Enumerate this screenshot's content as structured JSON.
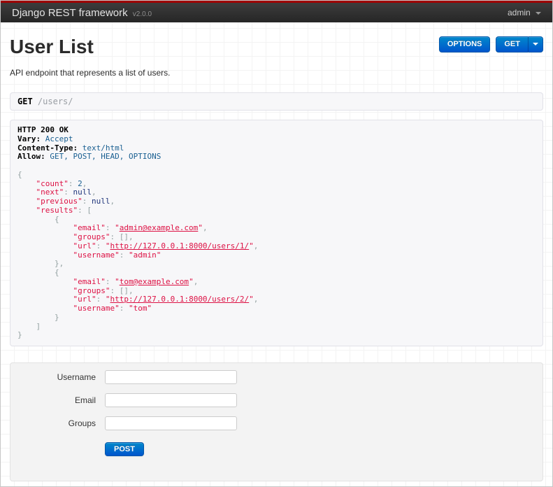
{
  "navbar": {
    "brand": "Django REST framework",
    "version": "v2.0.0",
    "user_menu": "admin"
  },
  "header": {
    "title": "User List",
    "description": "API endpoint that represents a list of users.",
    "options_button": "OPTIONS",
    "get_button": "GET"
  },
  "request_bar": {
    "method": "GET",
    "path": "/users/"
  },
  "response": {
    "status_line": "HTTP 200 OK",
    "headers": [
      {
        "name": "Vary:",
        "value": "Accept"
      },
      {
        "name": "Content-Type:",
        "value": "text/html"
      },
      {
        "name": "Allow:",
        "value": "GET, POST, HEAD, OPTIONS"
      }
    ],
    "body_json": {
      "count": 2,
      "next": null,
      "previous": null,
      "results": [
        {
          "email": "admin@example.com",
          "groups": [],
          "url": "http://127.0.0.1:8000/users/1/",
          "username": "admin"
        },
        {
          "email": "tom@example.com",
          "groups": [],
          "url": "http://127.0.0.1:8000/users/2/",
          "username": "tom"
        }
      ]
    },
    "lines": [
      [
        {
          "t": "b",
          "v": "HTTP 200 OK"
        }
      ],
      [
        {
          "t": "b",
          "v": "Vary:"
        },
        {
          "t": "pln",
          "v": " "
        },
        {
          "t": "lit",
          "v": "Accept"
        }
      ],
      [
        {
          "t": "b",
          "v": "Content-Type:"
        },
        {
          "t": "pln",
          "v": " "
        },
        {
          "t": "lit",
          "v": "text/html"
        }
      ],
      [
        {
          "t": "b",
          "v": "Allow:"
        },
        {
          "t": "pln",
          "v": " "
        },
        {
          "t": "lit",
          "v": "GET, POST, HEAD, OPTIONS"
        }
      ],
      [],
      [
        {
          "t": "pun",
          "v": "{"
        }
      ],
      [
        {
          "t": "pln",
          "v": "    "
        },
        {
          "t": "str",
          "v": "\"count\""
        },
        {
          "t": "pun",
          "v": ": "
        },
        {
          "t": "lit",
          "v": "2"
        },
        {
          "t": "pun",
          "v": ","
        }
      ],
      [
        {
          "t": "pln",
          "v": "    "
        },
        {
          "t": "str",
          "v": "\"next\""
        },
        {
          "t": "pun",
          "v": ": "
        },
        {
          "t": "kwd",
          "v": "null"
        },
        {
          "t": "pun",
          "v": ","
        }
      ],
      [
        {
          "t": "pln",
          "v": "    "
        },
        {
          "t": "str",
          "v": "\"previous\""
        },
        {
          "t": "pun",
          "v": ": "
        },
        {
          "t": "kwd",
          "v": "null"
        },
        {
          "t": "pun",
          "v": ","
        }
      ],
      [
        {
          "t": "pln",
          "v": "    "
        },
        {
          "t": "str",
          "v": "\"results\""
        },
        {
          "t": "pun",
          "v": ": ["
        }
      ],
      [
        {
          "t": "pln",
          "v": "        "
        },
        {
          "t": "pun",
          "v": "{"
        }
      ],
      [
        {
          "t": "pln",
          "v": "            "
        },
        {
          "t": "str",
          "v": "\"email\""
        },
        {
          "t": "pun",
          "v": ": "
        },
        {
          "t": "str",
          "v": "\""
        },
        {
          "t": "link",
          "v": "admin@example.com"
        },
        {
          "t": "str",
          "v": "\""
        },
        {
          "t": "pun",
          "v": ","
        }
      ],
      [
        {
          "t": "pln",
          "v": "            "
        },
        {
          "t": "str",
          "v": "\"groups\""
        },
        {
          "t": "pun",
          "v": ": [],"
        }
      ],
      [
        {
          "t": "pln",
          "v": "            "
        },
        {
          "t": "str",
          "v": "\"url\""
        },
        {
          "t": "pun",
          "v": ": "
        },
        {
          "t": "str",
          "v": "\""
        },
        {
          "t": "link",
          "v": "http://127.0.0.1:8000/users/1/"
        },
        {
          "t": "str",
          "v": "\""
        },
        {
          "t": "pun",
          "v": ","
        }
      ],
      [
        {
          "t": "pln",
          "v": "            "
        },
        {
          "t": "str",
          "v": "\"username\""
        },
        {
          "t": "pun",
          "v": ": "
        },
        {
          "t": "str",
          "v": "\"admin\""
        }
      ],
      [
        {
          "t": "pln",
          "v": "        "
        },
        {
          "t": "pun",
          "v": "},"
        }
      ],
      [
        {
          "t": "pln",
          "v": "        "
        },
        {
          "t": "pun",
          "v": "{"
        }
      ],
      [
        {
          "t": "pln",
          "v": "            "
        },
        {
          "t": "str",
          "v": "\"email\""
        },
        {
          "t": "pun",
          "v": ": "
        },
        {
          "t": "str",
          "v": "\""
        },
        {
          "t": "link",
          "v": "tom@example.com"
        },
        {
          "t": "str",
          "v": "\""
        },
        {
          "t": "pun",
          "v": ","
        }
      ],
      [
        {
          "t": "pln",
          "v": "            "
        },
        {
          "t": "str",
          "v": "\"groups\""
        },
        {
          "t": "pun",
          "v": ": [],"
        }
      ],
      [
        {
          "t": "pln",
          "v": "            "
        },
        {
          "t": "str",
          "v": "\"url\""
        },
        {
          "t": "pun",
          "v": ": "
        },
        {
          "t": "str",
          "v": "\""
        },
        {
          "t": "link",
          "v": "http://127.0.0.1:8000/users/2/"
        },
        {
          "t": "str",
          "v": "\""
        },
        {
          "t": "pun",
          "v": ","
        }
      ],
      [
        {
          "t": "pln",
          "v": "            "
        },
        {
          "t": "str",
          "v": "\"username\""
        },
        {
          "t": "pun",
          "v": ": "
        },
        {
          "t": "str",
          "v": "\"tom\""
        }
      ],
      [
        {
          "t": "pln",
          "v": "        "
        },
        {
          "t": "pun",
          "v": "}"
        }
      ],
      [
        {
          "t": "pln",
          "v": "    "
        },
        {
          "t": "pun",
          "v": "]"
        }
      ],
      [
        {
          "t": "pun",
          "v": "}"
        }
      ]
    ]
  },
  "form": {
    "fields": [
      {
        "label": "Username"
      },
      {
        "label": "Email"
      },
      {
        "label": "Groups"
      }
    ],
    "submit_label": "POST"
  },
  "colors": {
    "accent_red": "#9e0000",
    "navbar_bg": "#2d2d2d",
    "primary_button_top": "#0088cc",
    "primary_button_bottom": "#0055cc",
    "string_token": "#dd1144",
    "keyword_token": "#1e347b",
    "literal_token": "#195f91",
    "punctuation_token": "#93a1a1",
    "panel_bg": "#f7f7f9",
    "panel_border": "#e1e1e8"
  }
}
